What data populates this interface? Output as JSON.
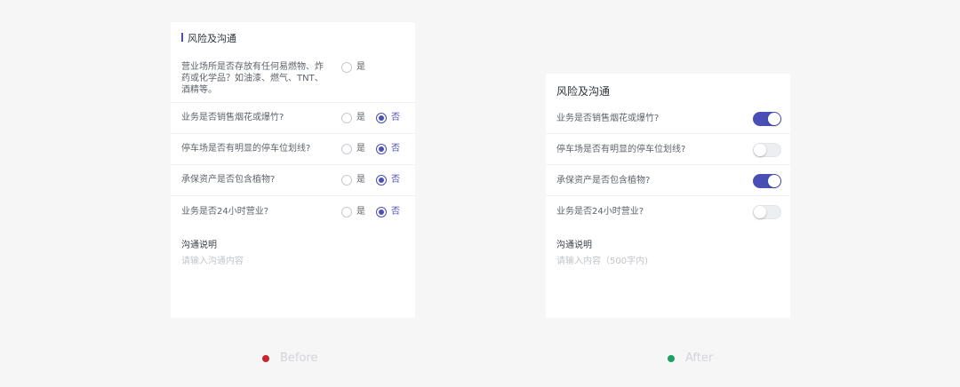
{
  "before": {
    "title": "风险及沟通",
    "q1": {
      "line1": "营业场所是否存放有任何易燃物、炸",
      "line2": "药或化学品？如油漆、燃气、TNT、",
      "line3": "酒精等。"
    },
    "q2": "业务是否销售烟花或爆竹?",
    "q3": "停车场是否有明显的停车位划线?",
    "q4": "承保资产是否包含植物?",
    "q5": "业务是否24小时营业?",
    "yes": "是",
    "no": "否",
    "comm_label": "沟通说明",
    "comm_placeholder": "请输入沟通内容"
  },
  "after": {
    "title": "风险及沟通",
    "q2": "业务是否销售烟花或爆竹?",
    "q3": "停车场是否有明显的停车位划线?",
    "q4": "承保资产是否包含植物?",
    "q5": "业务是否24小时营业?",
    "toggles": {
      "q2": true,
      "q3": false,
      "q4": true,
      "q5": false
    },
    "comm_label": "沟通说明",
    "comm_placeholder": "请输入内容（500字内)"
  },
  "captions": {
    "before": "Before",
    "after": "After",
    "before_color": "#c9252c",
    "after_color": "#1aa260"
  },
  "colors": {
    "accent": "#4a4fb8",
    "background": "#f6f6f7"
  }
}
